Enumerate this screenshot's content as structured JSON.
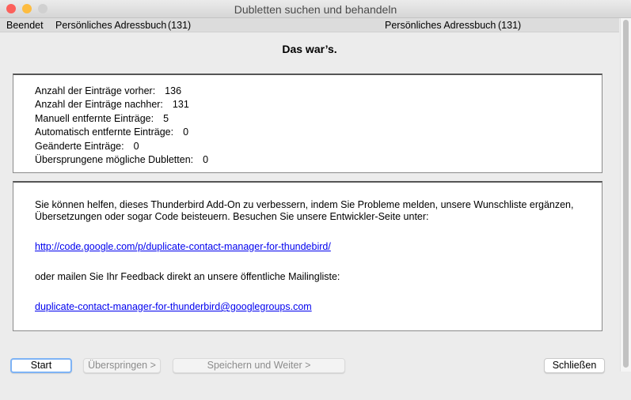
{
  "window": {
    "title": "Dubletten suchen und behandeln",
    "colors": {
      "close": "#fc605b",
      "minimize": "#fdbc40",
      "zoom": "#d0d0d0"
    }
  },
  "status": {
    "state": "Beendet",
    "left_book": "Persönliches Adressbuch",
    "left_count": "(131)",
    "right_book": "Persönliches Adressbuch",
    "right_count": "(131)"
  },
  "heading": "Das war’s.",
  "stats": [
    {
      "label": "Anzahl der Einträge vorher:",
      "value": "136"
    },
    {
      "label": "Anzahl der Einträge nachher:",
      "value": "131"
    },
    {
      "label": "Manuell entfernte Einträge:",
      "value": "5"
    },
    {
      "label": "Automatisch entfernte Einträge:",
      "value": "0"
    },
    {
      "label": "Geänderte Einträge:",
      "value": "0"
    },
    {
      "label": "Übersprungene mögliche Dubletten:",
      "value": "0"
    }
  ],
  "info": {
    "text1": "Sie können helfen, dieses Thunderbird Add-On zu verbessern, indem Sie Probleme melden, unsere Wunschliste ergänzen, Übersetzungen oder sogar Code beisteuern. Besuchen Sie unsere Entwickler-Seite unter:",
    "link1": "http://code.google.com/p/duplicate-contact-manager-for-thundebird/",
    "text2": "oder mailen Sie Ihr Feedback direkt an unsere öffentliche Mailingliste:",
    "link2": "duplicate-contact-manager-for-thunderbird@googlegroups.com"
  },
  "buttons": {
    "start": "Start",
    "skip": "Überspringen >",
    "save": "Speichern und Weiter >",
    "close": "Schließen"
  }
}
